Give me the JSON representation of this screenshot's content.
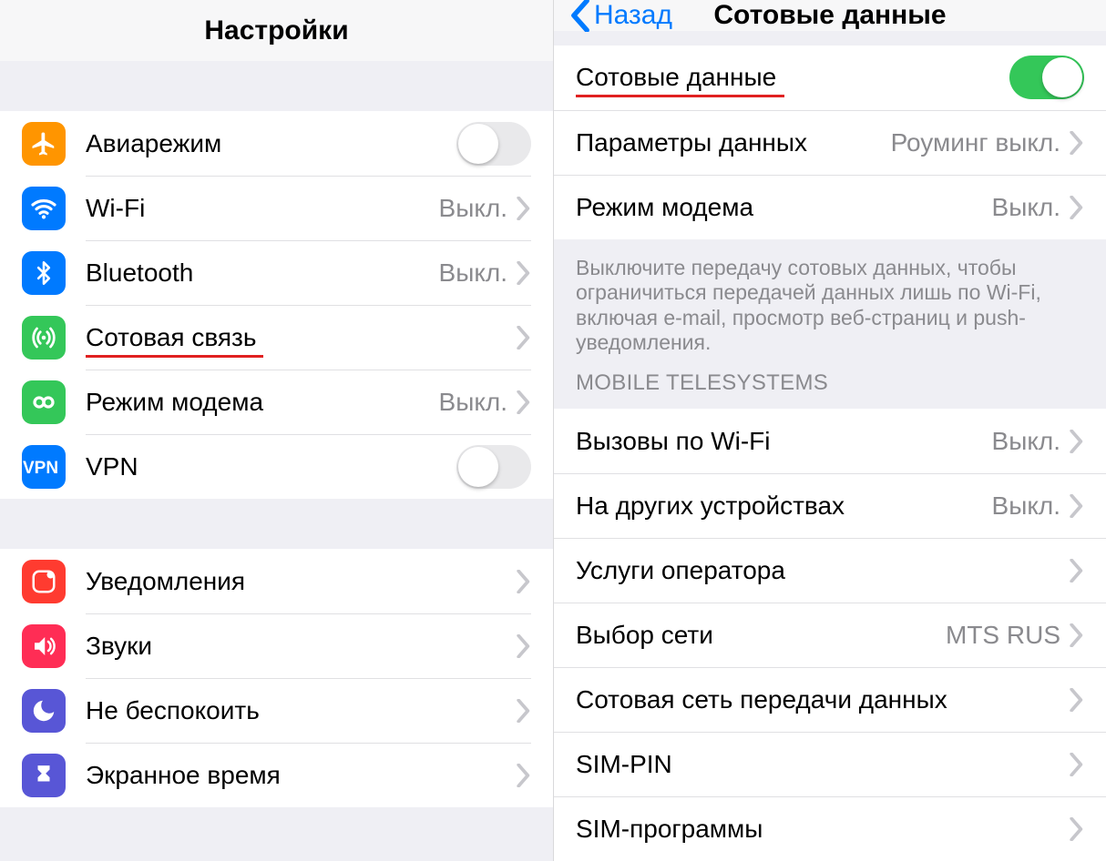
{
  "colors": {
    "orange": "#ff9500",
    "blue": "#007aff",
    "green": "#34c759",
    "red": "#ff3b30",
    "pink": "#ff2d55",
    "indigo": "#5856d6",
    "gray": "#8a8a8e"
  },
  "left": {
    "title": "Настройки",
    "group1": [
      {
        "icon": "airplane",
        "bg": "#ff9500",
        "label": "Авиарежим",
        "toggle": false
      },
      {
        "icon": "wifi",
        "bg": "#007aff",
        "label": "Wi-Fi",
        "status": "Выкл.",
        "chevron": true
      },
      {
        "icon": "bluetooth",
        "bg": "#007aff",
        "label": "Bluetooth",
        "status": "Выкл.",
        "chevron": true
      },
      {
        "icon": "antenna",
        "bg": "#34c759",
        "label": "Сотовая связь",
        "underline": true,
        "chevron": true
      },
      {
        "icon": "hotspot",
        "bg": "#34c759",
        "label": "Режим модема",
        "status": "Выкл.",
        "chevron": true
      },
      {
        "icon": "vpn",
        "bg": "#007aff",
        "label": "VPN",
        "toggle": false
      }
    ],
    "group2": [
      {
        "icon": "notif",
        "bg": "#ff3b30",
        "label": "Уведомления",
        "chevron": true
      },
      {
        "icon": "sound",
        "bg": "#ff2d55",
        "label": "Звуки",
        "chevron": true
      },
      {
        "icon": "dnd",
        "bg": "#5856d6",
        "label": "Не беспокоить",
        "chevron": true
      },
      {
        "icon": "hourglass",
        "bg": "#5856d6",
        "label": "Экранное время",
        "chevron": true
      }
    ]
  },
  "right": {
    "back": "Назад",
    "title": "Сотовые данные",
    "group1": [
      {
        "label": "Сотовые данные",
        "underline": true,
        "toggle": true
      },
      {
        "label": "Параметры данных",
        "status": "Роуминг выкл.",
        "chevron": true
      },
      {
        "label": "Режим модема",
        "status": "Выкл.",
        "chevron": true
      }
    ],
    "footer": "Выключите передачу сотовых данных, чтобы ограничиться передачей данных лишь по Wi-Fi, включая e-mail, просмотр веб-страниц и push-уведомления.",
    "carrier": "MOBILE TELESYSTEMS",
    "group2": [
      {
        "label": "Вызовы по Wi-Fi",
        "status": "Выкл.",
        "chevron": true
      },
      {
        "label": "На других устройствах",
        "status": "Выкл.",
        "chevron": true
      },
      {
        "label": "Услуги оператора",
        "chevron": true
      },
      {
        "label": "Выбор сети",
        "status": "MTS RUS",
        "chevron": true
      },
      {
        "label": "Сотовая сеть передачи данных",
        "chevron": true
      },
      {
        "label": "SIM-PIN",
        "chevron": true
      },
      {
        "label": "SIM-программы",
        "chevron": true
      }
    ]
  }
}
